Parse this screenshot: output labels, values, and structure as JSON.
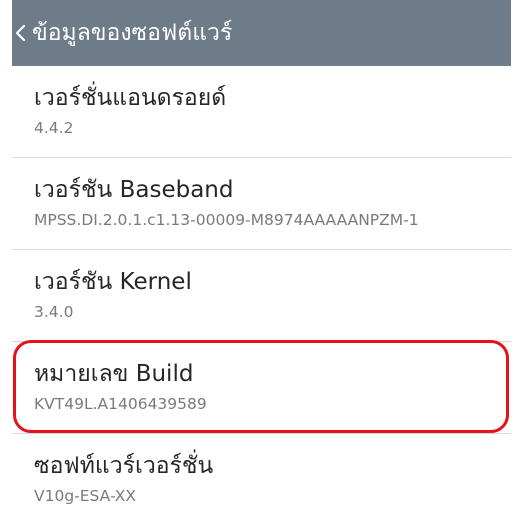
{
  "header": {
    "title": "ข้อมูลของซอฟต์แวร์",
    "back_icon": "chevron-left-icon"
  },
  "items": [
    {
      "title": "เวอร์ชั่นแอนดรอยด์",
      "value": "4.4.2"
    },
    {
      "title": "เวอร์ชัน Baseband",
      "value": "MPSS.DI.2.0.1.c1.13-00009-M8974AAAAANPZM-1"
    },
    {
      "title": "เวอร์ชัน Kernel",
      "value": "3.4.0"
    },
    {
      "title": "หมายเลข Build",
      "value": "KVT49L.A1406439589"
    },
    {
      "title": "ซอฟท์แวร์เวอร์ชั่น",
      "value": "V10g-ESA-XX"
    }
  ],
  "colors": {
    "header_bg": "#6e7b89",
    "highlight": "#e8101a",
    "title_text": "#262626",
    "value_text": "#7a7a7a"
  }
}
